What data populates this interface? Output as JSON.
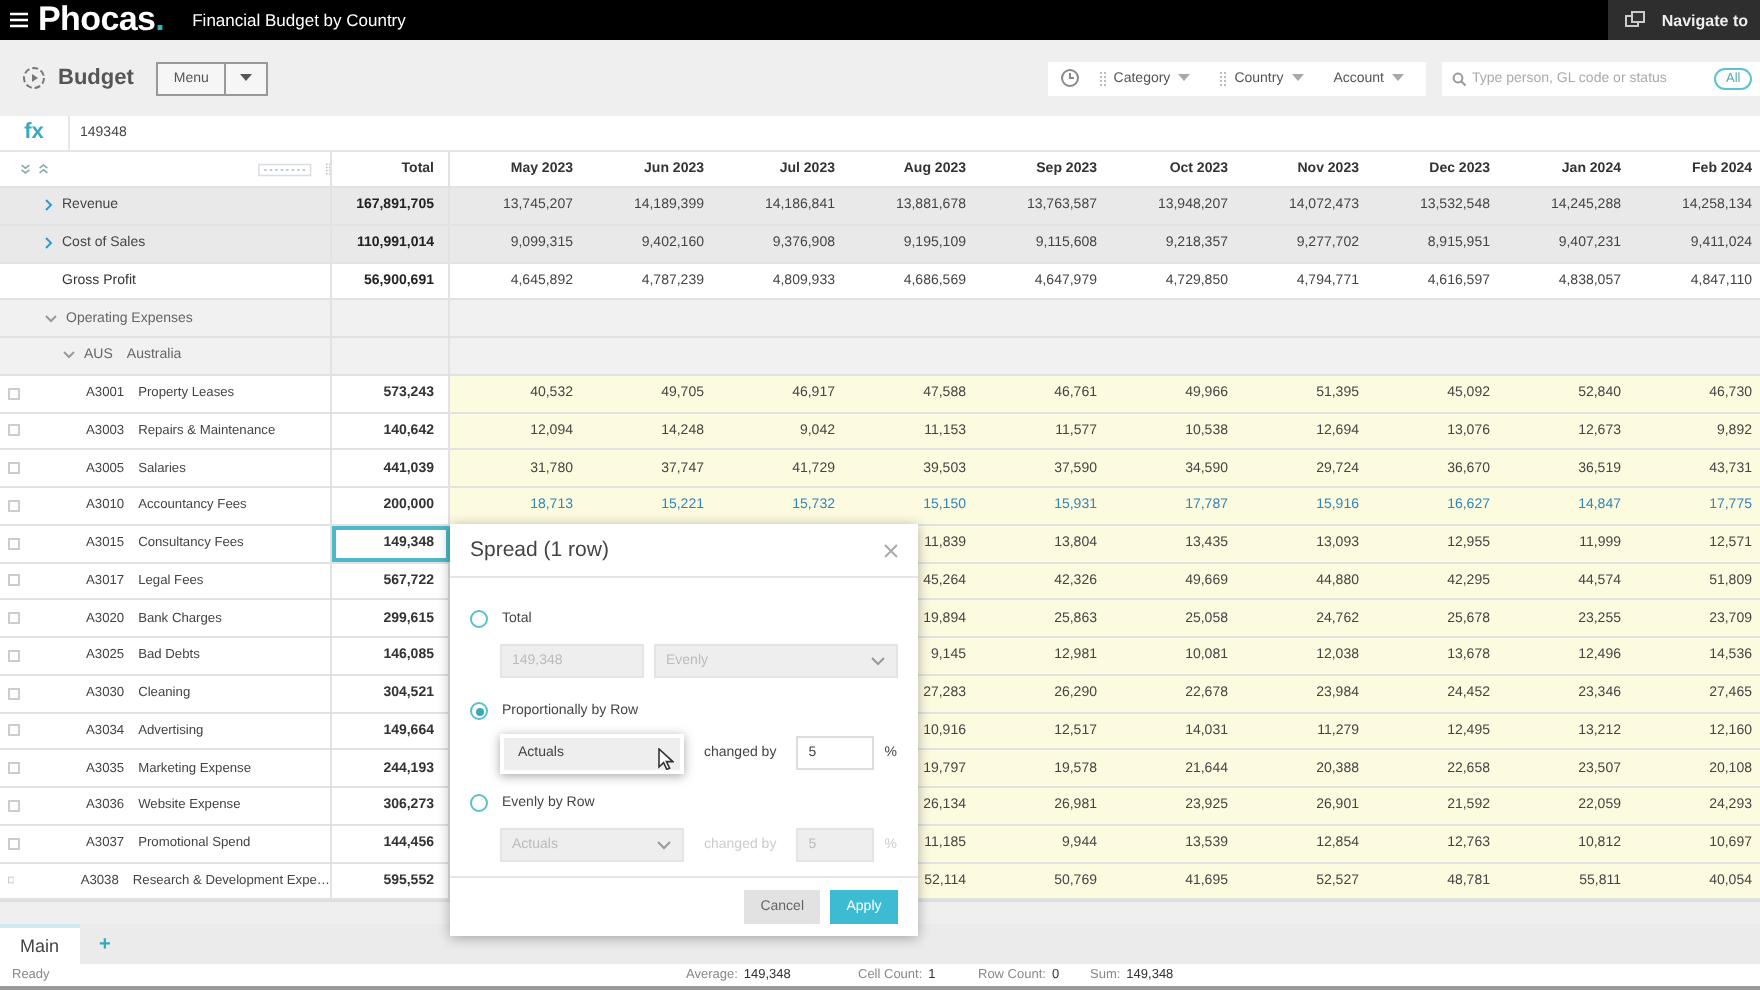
{
  "app_bar": {
    "logo": "Phocas",
    "logo_dot": ".",
    "title": "Financial Budget by Country",
    "navigate": "Navigate to"
  },
  "toolbar": {
    "title": "Budget",
    "menu_button": "Menu",
    "filters": [
      {
        "label": "Category",
        "grip": true
      },
      {
        "label": "Country",
        "grip": true
      },
      {
        "label": "Account",
        "grip": false
      }
    ],
    "search": {
      "placeholder": "Type person, GL code or status"
    },
    "scope": "All"
  },
  "formula_bar": {
    "label": "fx",
    "value": "149348"
  },
  "grid": {
    "total_header": "Total",
    "months": [
      "May 2023",
      "Jun 2023",
      "Jul 2023",
      "Aug 2023",
      "Sep 2023",
      "Oct 2023",
      "Nov 2023",
      "Dec 2023",
      "Jan 2024",
      "Feb 2024"
    ],
    "rows": [
      {
        "kind": "summary",
        "label": "Revenue",
        "expanded": false,
        "total": "167,891,705",
        "values": [
          "13,745,207",
          "14,189,399",
          "14,186,841",
          "13,881,678",
          "13,763,587",
          "13,948,207",
          "14,072,473",
          "13,532,548",
          "14,245,288",
          "14,258,134"
        ]
      },
      {
        "kind": "summary",
        "label": "Cost of Sales",
        "expanded": false,
        "total": "110,991,014",
        "values": [
          "9,099,315",
          "9,402,160",
          "9,376,908",
          "9,195,109",
          "9,115,608",
          "9,218,357",
          "9,277,702",
          "8,915,951",
          "9,407,231",
          "9,411,024"
        ]
      },
      {
        "kind": "total",
        "label": "Gross Profit",
        "total": "56,900,691",
        "values": [
          "4,645,892",
          "4,787,239",
          "4,809,933",
          "4,686,569",
          "4,647,979",
          "4,729,850",
          "4,794,771",
          "4,616,597",
          "4,838,057",
          "4,847,110"
        ]
      },
      {
        "kind": "group",
        "label": "Operating Expenses",
        "expanded": true,
        "children": [
          {
            "kind": "group",
            "code": "AUS",
            "label": "Australia",
            "expanded": true,
            "children": [
              {
                "kind": "account",
                "code": "A3001",
                "label": "Property Leases",
                "selected": false,
                "adjusted": false,
                "total": "573,243",
                "values": [
                  "40,532",
                  "49,705",
                  "46,917",
                  "47,588",
                  "46,761",
                  "49,966",
                  "51,395",
                  "45,092",
                  "52,840",
                  "46,730"
                ]
              },
              {
                "kind": "account",
                "code": "A3003",
                "label": "Repairs & Maintenance",
                "selected": false,
                "adjusted": false,
                "total": "140,642",
                "values": [
                  "12,094",
                  "14,248",
                  "9,042",
                  "11,153",
                  "11,577",
                  "10,538",
                  "12,694",
                  "13,076",
                  "12,673",
                  "9,892"
                ]
              },
              {
                "kind": "account",
                "code": "A3005",
                "label": "Salaries",
                "selected": false,
                "adjusted": false,
                "total": "441,039",
                "values": [
                  "31,780",
                  "37,747",
                  "41,729",
                  "39,503",
                  "37,590",
                  "34,590",
                  "29,724",
                  "36,670",
                  "36,519",
                  "43,731"
                ]
              },
              {
                "kind": "account",
                "code": "A3010",
                "label": "Accountancy Fees",
                "selected": false,
                "adjusted": true,
                "total": "200,000",
                "values": [
                  "18,713",
                  "15,221",
                  "15,732",
                  "15,150",
                  "15,931",
                  "17,787",
                  "15,916",
                  "16,627",
                  "14,847",
                  "17,775"
                ]
              },
              {
                "kind": "account",
                "code": "A3015",
                "label": "Consultancy Fees",
                "selected": true,
                "adjusted": false,
                "total": "149,348",
                "values": [
                  "11,839",
                  "13,804",
                  "13,435",
                  "13,093",
                  "12,955",
                  "11,999",
                  "12,571"
                ]
              },
              {
                "kind": "account",
                "code": "A3017",
                "label": "Legal Fees",
                "selected": false,
                "adjusted": false,
                "total": "567,722",
                "values": [
                  "45,264",
                  "42,326",
                  "49,669",
                  "44,880",
                  "42,295",
                  "44,574",
                  "51,809"
                ]
              },
              {
                "kind": "account",
                "code": "A3020",
                "label": "Bank Charges",
                "selected": false,
                "adjusted": false,
                "total": "299,615",
                "values": [
                  "19,894",
                  "25,863",
                  "25,058",
                  "24,762",
                  "25,678",
                  "23,255",
                  "23,709"
                ]
              },
              {
                "kind": "account",
                "code": "A3025",
                "label": "Bad Debts",
                "selected": false,
                "adjusted": false,
                "total": "146,085",
                "values": [
                  "9,145",
                  "12,981",
                  "10,081",
                  "12,038",
                  "13,678",
                  "12,496",
                  "14,536"
                ]
              },
              {
                "kind": "account",
                "code": "A3030",
                "label": "Cleaning",
                "selected": false,
                "adjusted": false,
                "total": "304,521",
                "values": [
                  "27,283",
                  "26,290",
                  "22,678",
                  "23,984",
                  "24,452",
                  "23,346",
                  "27,465"
                ]
              },
              {
                "kind": "account",
                "code": "A3034",
                "label": "Advertising",
                "selected": false,
                "adjusted": false,
                "total": "149,664",
                "values": [
                  "10,916",
                  "12,517",
                  "14,031",
                  "11,279",
                  "12,495",
                  "13,212",
                  "12,160"
                ]
              },
              {
                "kind": "account",
                "code": "A3035",
                "label": "Marketing Expense",
                "selected": false,
                "adjusted": false,
                "total": "244,193",
                "values": [
                  "19,797",
                  "19,578",
                  "21,644",
                  "20,388",
                  "22,658",
                  "23,507",
                  "20,108"
                ]
              },
              {
                "kind": "account",
                "code": "A3036",
                "label": "Website Expense",
                "selected": false,
                "adjusted": false,
                "total": "306,273",
                "values": [
                  "26,134",
                  "26,981",
                  "23,925",
                  "26,901",
                  "21,592",
                  "22,059",
                  "24,293"
                ]
              },
              {
                "kind": "account",
                "code": "A3037",
                "label": "Promotional Spend",
                "selected": false,
                "adjusted": false,
                "total": "144,456",
                "values": [
                  "11,185",
                  "9,944",
                  "13,539",
                  "12,854",
                  "12,763",
                  "10,812",
                  "10,697"
                ]
              },
              {
                "kind": "account",
                "code": "A3038",
                "label": "Research & Development Expe…",
                "selected": false,
                "adjusted": false,
                "total": "595,552",
                "values": [
                  "52,114",
                  "50,769",
                  "41,695",
                  "52,527",
                  "48,781",
                  "55,811",
                  "40,054"
                ]
              }
            ]
          }
        ]
      }
    ]
  },
  "dialog": {
    "title": "Spread (1 row)",
    "options": [
      {
        "kind": "total",
        "label": "Total",
        "selected": false,
        "amount": "149,348",
        "method": "Evenly"
      },
      {
        "kind": "by_row",
        "label": "Proportionally by Row",
        "selected": true,
        "basis": "Actuals",
        "basis_open": true,
        "changed_by_label": "changed by",
        "change": "5",
        "unit": "%"
      },
      {
        "kind": "by_row",
        "label": "Evenly by Row",
        "selected": false,
        "basis": "Actuals",
        "basis_open": false,
        "changed_by_label": "changed by",
        "change": "5",
        "unit": "%"
      }
    ],
    "buttons": [
      {
        "kind": "secondary",
        "label": "Cancel"
      },
      {
        "kind": "primary",
        "label": "Apply"
      }
    ]
  },
  "sheet_tabs": [
    {
      "label": "Main",
      "selected": true
    }
  ],
  "add_tab": "+",
  "status_bar": {
    "state": "Ready",
    "items": [
      {
        "label": "Average:",
        "value": "149,348"
      },
      {
        "label": "Cell Count:",
        "value": "1"
      },
      {
        "label": "Row Count:",
        "value": "0"
      },
      {
        "label": "Sum:",
        "value": "149,348"
      }
    ]
  }
}
